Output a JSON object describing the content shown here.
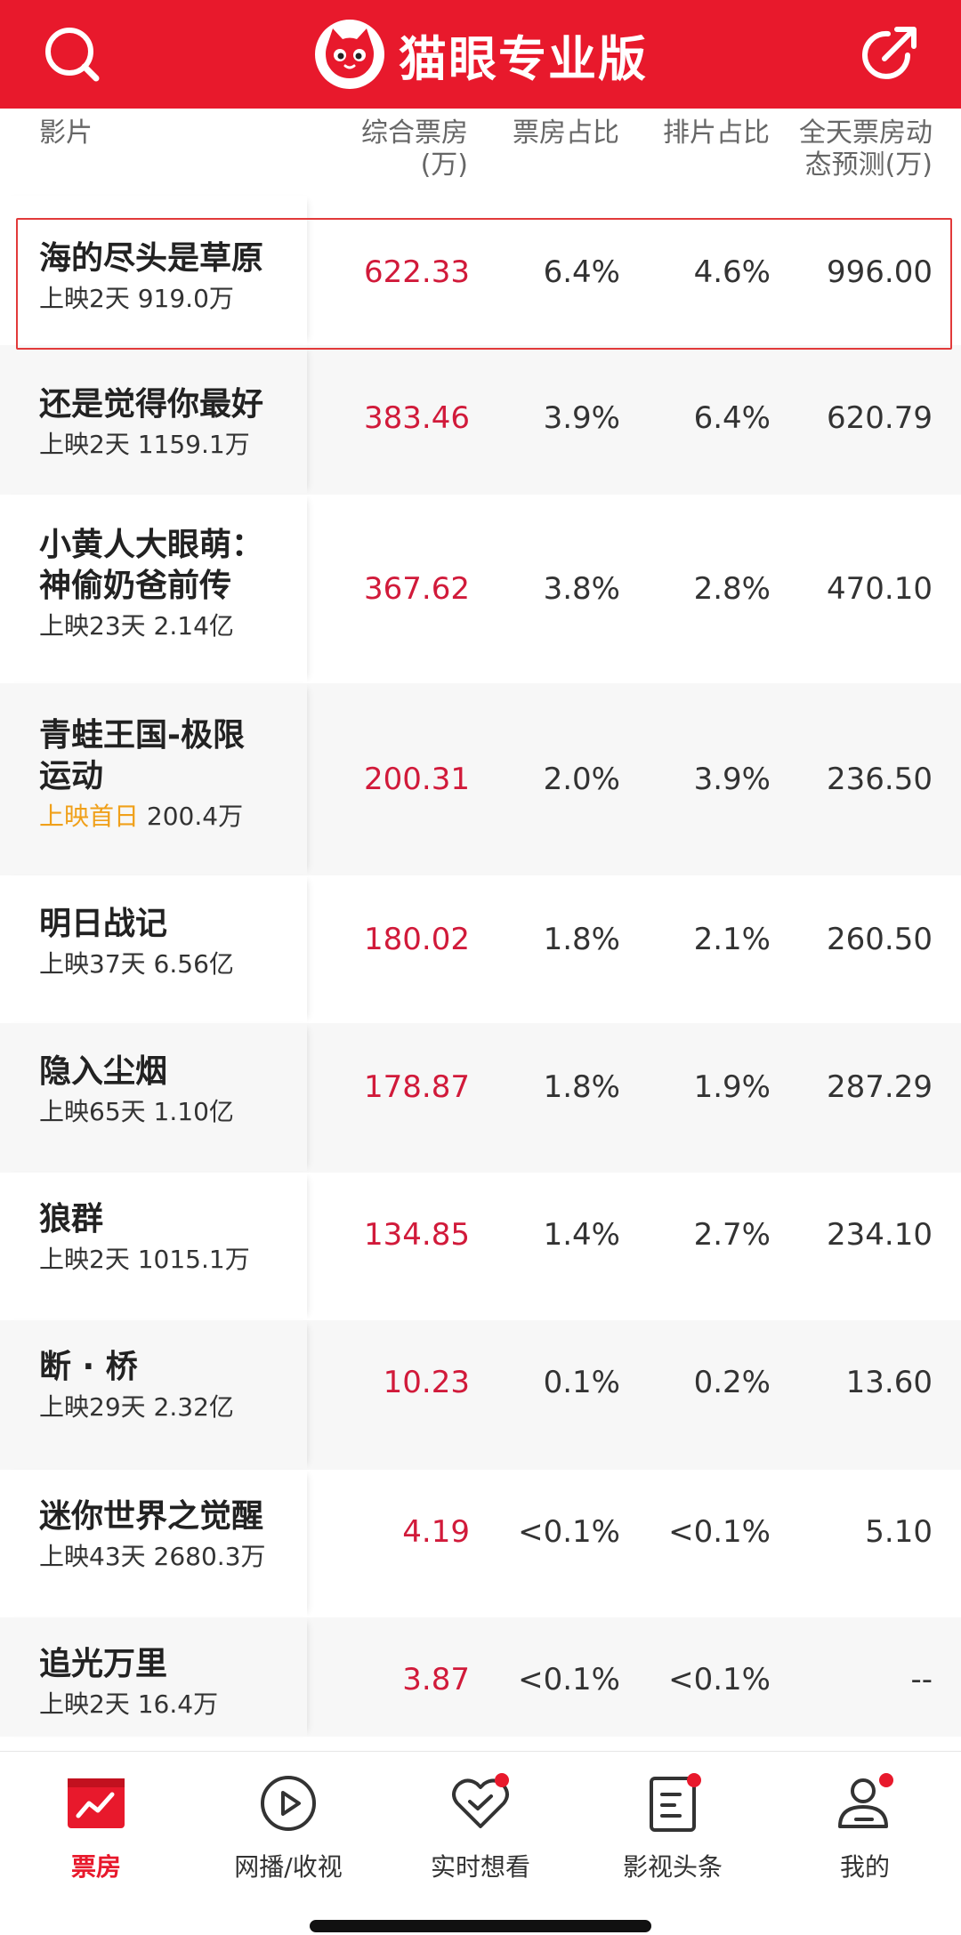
{
  "header": {
    "title": "猫眼专业版",
    "search_icon": "search-icon",
    "share_icon": "share-icon",
    "logo_icon": "cat-logo-icon",
    "color": "#e8192c"
  },
  "columns": {
    "film": "影片",
    "box_office": [
      "综合票房",
      "(万)"
    ],
    "box_share": "票房占比",
    "screen_share": "排片占比",
    "forecast": [
      "全天票房动",
      "态预测(万)"
    ]
  },
  "rows": [
    {
      "name": [
        "海的尽头是草原"
      ],
      "released": "上映2天",
      "total": "919.0万",
      "box": "622.33",
      "box_share": "6.4%",
      "screen_share": "4.6%",
      "forecast": "996.00"
    },
    {
      "name": [
        "还是觉得你最好"
      ],
      "released": "上映2天",
      "total": "1159.1万",
      "box": "383.46",
      "box_share": "3.9%",
      "screen_share": "6.4%",
      "forecast": "620.79"
    },
    {
      "name": [
        "小黄人大眼萌：",
        "神偷奶爸前传"
      ],
      "released": "上映23天",
      "total": "2.14亿",
      "box": "367.62",
      "box_share": "3.8%",
      "screen_share": "2.8%",
      "forecast": "470.10"
    },
    {
      "name": [
        "青蛙王国-极限",
        "运动"
      ],
      "released": "上映首日",
      "total": "200.4万",
      "box": "200.31",
      "box_share": "2.0%",
      "screen_share": "3.9%",
      "forecast": "236.50"
    },
    {
      "name": [
        "明日战记"
      ],
      "released": "上映37天",
      "total": "6.56亿",
      "box": "180.02",
      "box_share": "1.8%",
      "screen_share": "2.1%",
      "forecast": "260.50"
    },
    {
      "name": [
        "隐入尘烟"
      ],
      "released": "上映65天",
      "total": "1.10亿",
      "box": "178.87",
      "box_share": "1.8%",
      "screen_share": "1.9%",
      "forecast": "287.29"
    },
    {
      "name": [
        "狼群"
      ],
      "released": "上映2天",
      "total": "1015.1万",
      "box": "134.85",
      "box_share": "1.4%",
      "screen_share": "2.7%",
      "forecast": "234.10"
    },
    {
      "name": [
        "断 · 桥"
      ],
      "released": "上映29天",
      "total": "2.32亿",
      "box": "10.23",
      "box_share": "0.1%",
      "screen_share": "0.2%",
      "forecast": "13.60"
    },
    {
      "name": [
        "迷你世界之觉醒"
      ],
      "released": "上映43天",
      "total": "2680.3万",
      "box": "4.19",
      "box_share": "<0.1%",
      "screen_share": "<0.1%",
      "forecast": "5.10"
    },
    {
      "name": [
        "追光万里"
      ],
      "released": "上映2天",
      "total": "16.4万",
      "box": "3.87",
      "box_share": "<0.1%",
      "screen_share": "<0.1%",
      "forecast": "--"
    }
  ],
  "tabbar": [
    {
      "label": "票房",
      "icon": "box-office-chart-icon",
      "active": true
    },
    {
      "label": "网播/收视",
      "icon": "play-circle-icon",
      "active": false
    },
    {
      "label": "实时想看",
      "icon": "heart-check-icon",
      "active": false,
      "badge": true
    },
    {
      "label": "影视头条",
      "icon": "news-doc-icon",
      "active": false,
      "badge": true
    },
    {
      "label": "我的",
      "icon": "user-icon",
      "active": false,
      "badge": true
    }
  ]
}
